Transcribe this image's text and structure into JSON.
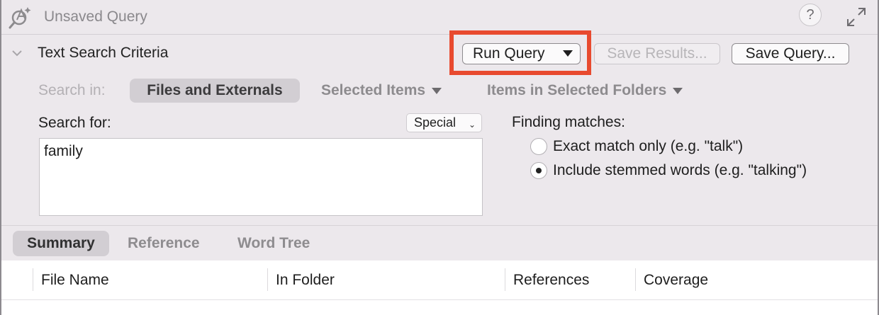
{
  "window": {
    "title": "Unsaved Query",
    "help_label": "?"
  },
  "criteria": {
    "title": "Text Search Criteria",
    "run_query_label": "Run Query",
    "save_results_label": "Save Results...",
    "save_query_label": "Save Query...",
    "highlight_color": "#e84a2f"
  },
  "search_in": {
    "label": "Search in:",
    "options": [
      {
        "label": "Files and Externals",
        "selected": true
      },
      {
        "label": "Selected Items",
        "selected": false
      },
      {
        "label": "Items in Selected Folders",
        "selected": false
      }
    ]
  },
  "search_for": {
    "label": "Search for:",
    "special_label": "Special",
    "value": "family"
  },
  "finding_matches": {
    "label": "Finding matches:",
    "options": [
      {
        "label": "Exact match only (e.g. \"talk\")",
        "checked": false
      },
      {
        "label": "Include stemmed words (e.g. \"talking\")",
        "checked": true
      }
    ]
  },
  "tabs": [
    {
      "label": "Summary",
      "active": true
    },
    {
      "label": "Reference",
      "active": false
    },
    {
      "label": "Word Tree",
      "active": false
    }
  ],
  "table": {
    "columns": [
      "File Name",
      "In Folder",
      "References",
      "Coverage"
    ]
  }
}
